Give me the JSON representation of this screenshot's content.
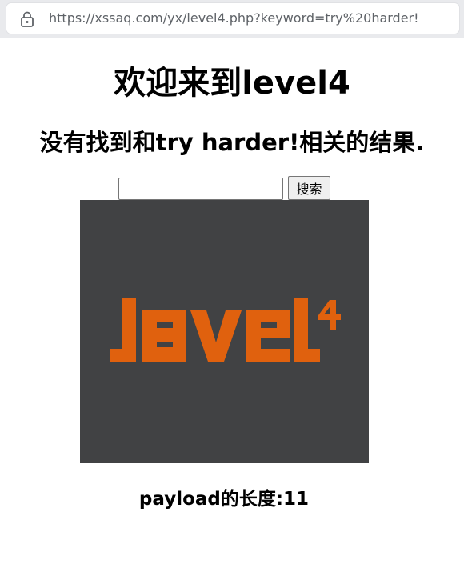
{
  "browser": {
    "url": "https://xssaq.com/yx/level4.php?keyword=try%20harder!"
  },
  "page": {
    "title": "欢迎来到level4",
    "result_message": "没有找到和try harder!相关的结果.",
    "search": {
      "value": "",
      "button_label": "搜索"
    },
    "logo": {
      "text": "level4",
      "color": "#e0610e",
      "background": "#414244"
    },
    "payload_length": "payload的长度:11"
  }
}
